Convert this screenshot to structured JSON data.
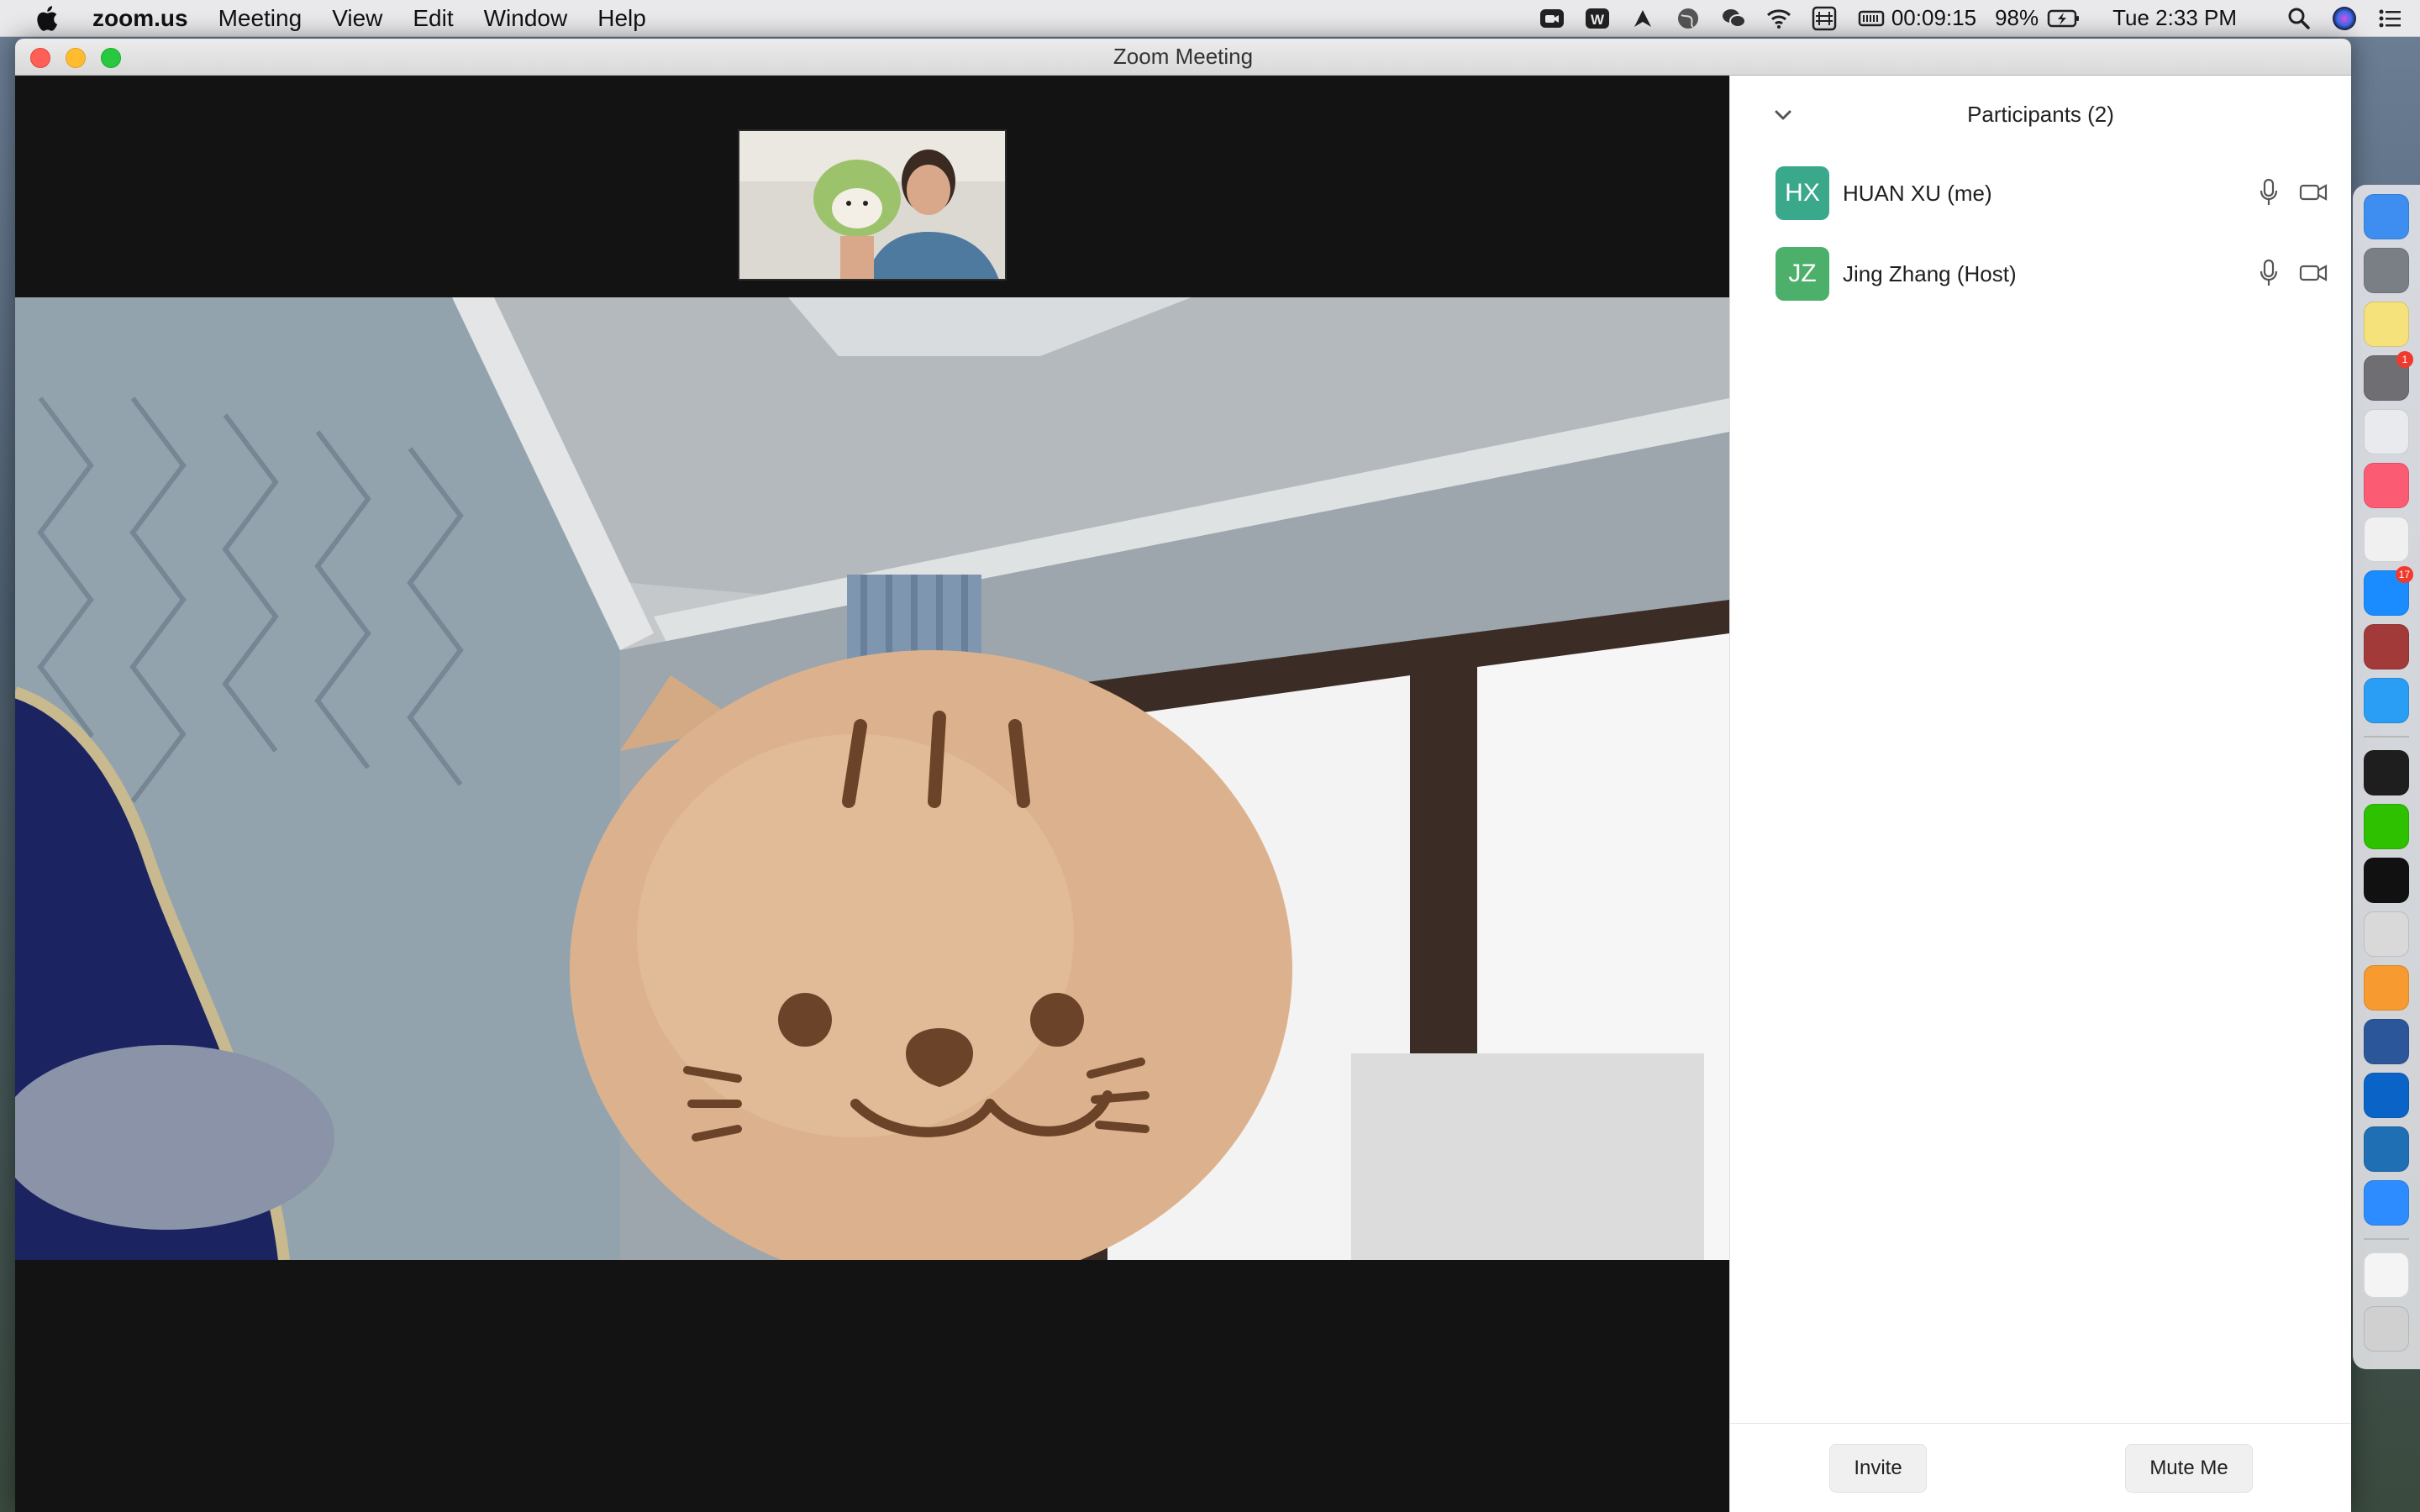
{
  "menubar": {
    "app_name": "zoom.us",
    "menus": [
      "Meeting",
      "View",
      "Edit",
      "Window",
      "Help"
    ],
    "timer": "00:09:15",
    "battery": "98%",
    "clock": "Tue 2:33 PM",
    "status_icons": [
      "zoom-video-icon",
      "w-icon",
      "tool-icon",
      "globe-icon",
      "wechat-icon",
      "wifi-icon",
      "input-method-icon",
      "battery-meter-icon"
    ]
  },
  "window": {
    "title": "Zoom Meeting"
  },
  "participants_panel": {
    "title": "Participants (2)",
    "participants": [
      {
        "initials": "HX",
        "name": "HUAN XU (me)",
        "color": "#3aa88b"
      },
      {
        "initials": "JZ",
        "name": "Jing Zhang (Host)",
        "color": "#4caf6a"
      }
    ],
    "invite_label": "Invite",
    "mute_label": "Mute Me"
  },
  "dock": {
    "items": [
      {
        "name": "finder-icon",
        "color": "#3d8ef0"
      },
      {
        "name": "launchpad-icon",
        "color": "#7a7f86"
      },
      {
        "name": "notes-icon",
        "color": "#f6e27a"
      },
      {
        "name": "system-preferences-icon",
        "color": "#6e6e73",
        "badge": "1"
      },
      {
        "name": "chrome-icon",
        "color": "#e8eaed"
      },
      {
        "name": "music-icon",
        "color": "#fb5c74"
      },
      {
        "name": "script-editor-icon",
        "color": "#f0f0f0"
      },
      {
        "name": "app-store-icon",
        "color": "#1a8cff",
        "badge": "17"
      },
      {
        "name": "dictionary-icon",
        "color": "#a33a3a"
      },
      {
        "name": "safari-icon",
        "color": "#2a9df4"
      },
      {
        "name": "terminal-icon",
        "color": "#1e1e1e"
      },
      {
        "name": "wechat-icon",
        "color": "#2dc100"
      },
      {
        "name": "iterm-icon",
        "color": "#111111"
      },
      {
        "name": "keychain-icon",
        "color": "#d9d9d9"
      },
      {
        "name": "sublime-text-icon",
        "color": "#f79a2f"
      },
      {
        "name": "word-icon",
        "color": "#2b579a"
      },
      {
        "name": "outlook-icon",
        "color": "#0a64c8"
      },
      {
        "name": "vpn-icon",
        "color": "#1f6fb5"
      },
      {
        "name": "zoom-icon",
        "color": "#2d8cff"
      },
      {
        "name": "document-icon",
        "color": "#f4f4f4"
      },
      {
        "name": "trash-icon",
        "color": "#d0d0d0"
      }
    ]
  }
}
